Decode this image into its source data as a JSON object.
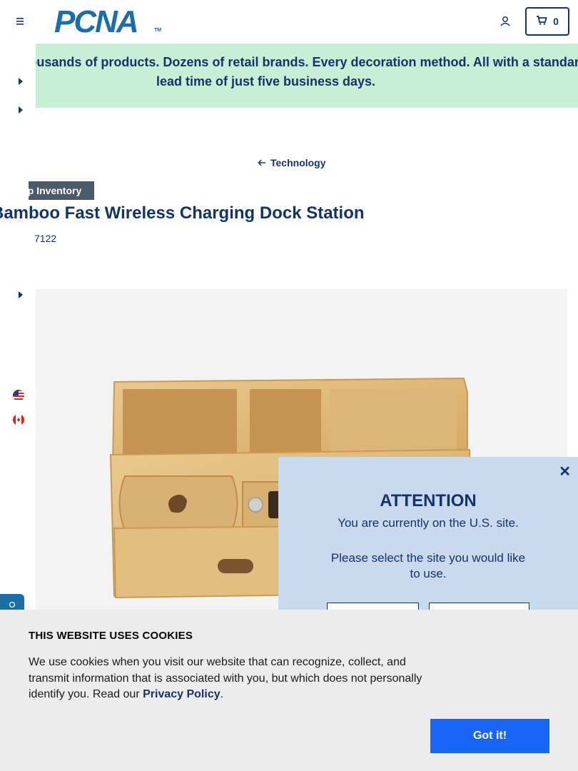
{
  "header": {
    "logo_text": "PCNA",
    "logo_tm": "TM",
    "cart_count": "0"
  },
  "promo": {
    "text": "Why Wait? Thousands of products. Dozens of retail brands. Every decoration method. All with a standard lead time of just five business days."
  },
  "breadcrumb": {
    "back_label": "Technology"
  },
  "product": {
    "badge": "Ship Inventory",
    "title": "Bamboo Fast Wireless Charging Dock Station",
    "sku": "7122"
  },
  "modal": {
    "title": "ATTENTION",
    "line1": "You are currently on the U.S. site.",
    "line2": "Please select the site you would like to use."
  },
  "cookies": {
    "title": "THIS WEBSITE USES COOKIES",
    "text_before": "We use cookies when you visit our website that can recognize, collect, and transmit information that is associated with you, but which does not personally identify you. Read our ",
    "link": "Privacy Policy",
    "text_after": ".",
    "button": "Got it!"
  },
  "colors": {
    "brand_navy": "#13346b",
    "promo_bg": "#c6efd6",
    "cookie_button": "#1766f5",
    "modal_bg": "#c9d9ee"
  }
}
